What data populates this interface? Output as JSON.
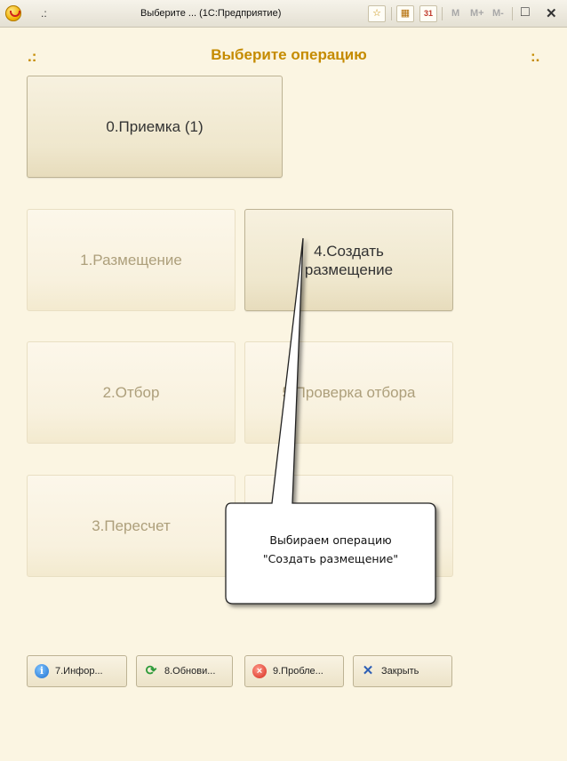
{
  "window": {
    "dots": ".:",
    "title": "Выберите ... (1С:Предприятие)",
    "tools": {
      "star": "☆",
      "calc": "▦",
      "calendar": "31",
      "m": "M",
      "mplus": "M+",
      "mminus": "M-",
      "maximize": "□",
      "close": "✕"
    }
  },
  "header": {
    "left_mark": ".:",
    "title": "Выберите операцию",
    "right_mark": ":."
  },
  "operations": [
    {
      "label": "0.Приемка (1)",
      "state": "active"
    },
    {
      "label": "1.Размещение",
      "state": "disabled"
    },
    {
      "label": "4.Создать размещение",
      "state": "active"
    },
    {
      "label": "2.Отбор",
      "state": "disabled"
    },
    {
      "label": "5.Проверка отбора",
      "state": "disabled"
    },
    {
      "label": "3.Пересчет",
      "state": "disabled"
    }
  ],
  "footer_buttons": [
    {
      "label": "7.Инфор...",
      "icon": "info-icon"
    },
    {
      "label": "8.Обнови...",
      "icon": "refresh-icon"
    },
    {
      "label": "9.Пробле...",
      "icon": "stop-icon"
    },
    {
      "label": "Закрыть",
      "icon": "close-icon"
    }
  ],
  "callout": {
    "line1": "Выбираем операцию",
    "line2": "\"Создать размещение\""
  },
  "colors": {
    "accent": "#c58b00",
    "background": "#fbf5e2",
    "disabled_text": "#ad9f7b"
  }
}
